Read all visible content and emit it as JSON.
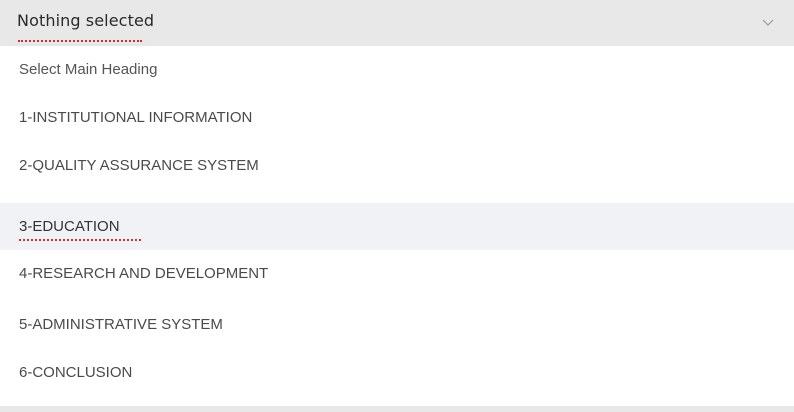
{
  "select": {
    "placeholder_label": "Nothing selected",
    "chevron_icon": "chevron-down-icon"
  },
  "menu": {
    "items": [
      {
        "label": "Select Main Heading"
      },
      {
        "label": "1-INSTITUTIONAL INFORMATION"
      },
      {
        "label": "2-QUALITY ASSURANCE SYSTEM"
      },
      {
        "label": "3-EDUCATION",
        "active": true
      },
      {
        "label": "4-RESEARCH AND DEVELOPMENT"
      },
      {
        "label": "5-ADMINISTRATIVE SYSTEM"
      },
      {
        "label": "6-CONCLUSION"
      }
    ]
  },
  "colors": {
    "toggle_bg": "#e8e8e8",
    "active_item_bg": "#f1f2f6",
    "spellcheck_underline": "#d22b2b"
  }
}
